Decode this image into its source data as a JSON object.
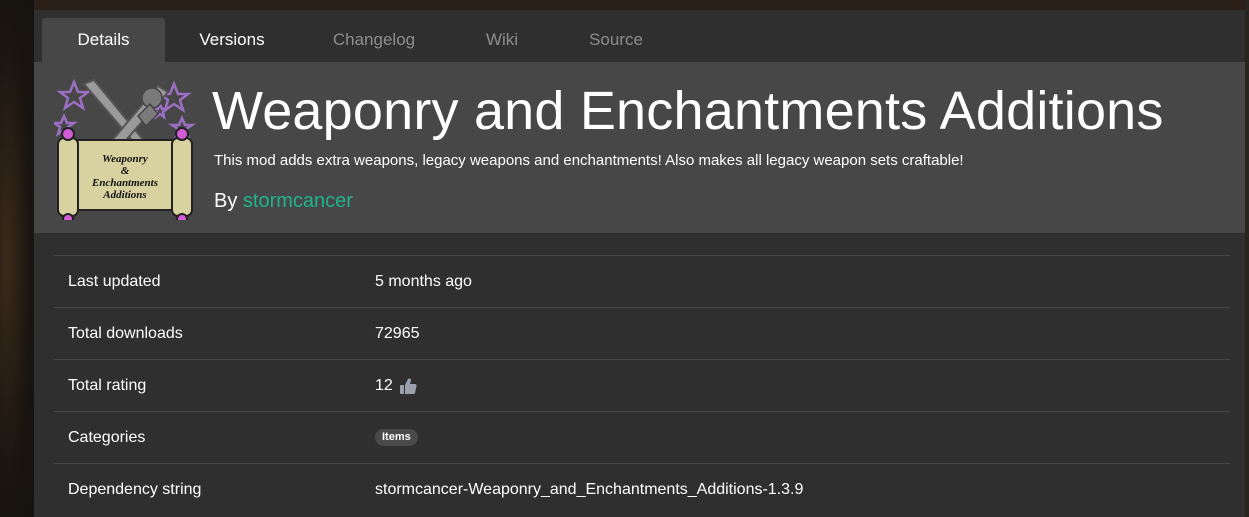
{
  "tabs": [
    {
      "label": "Details",
      "active": true
    },
    {
      "label": "Versions",
      "active": false
    },
    {
      "label": "Changelog",
      "active": false
    },
    {
      "label": "Wiki",
      "active": false
    },
    {
      "label": "Source",
      "active": false
    }
  ],
  "mod": {
    "title": "Weaponry and Enchantments Additions",
    "description": "This mod adds extra weapons, legacy weapons and enchantments! Also makes all legacy weapon sets craftable!",
    "by_label": "By",
    "author": "stormcancer",
    "logo_text": [
      "Weaponry",
      "&",
      "Enchantments",
      "Additions"
    ]
  },
  "details": {
    "rows": [
      {
        "label": "Last updated",
        "value": "5 months ago"
      },
      {
        "label": "Total downloads",
        "value": "72965"
      },
      {
        "label": "Total rating",
        "value": "12",
        "icon": "thumbs-up-icon"
      },
      {
        "label": "Categories",
        "value": "Items",
        "type": "badge"
      },
      {
        "label": "Dependency string",
        "value": "stormcancer-Weaponry_and_Enchantments_Additions-1.3.9"
      }
    ]
  },
  "colors": {
    "accent": "#1fb38a",
    "panel": "#2f2f2f",
    "header": "#474747"
  }
}
